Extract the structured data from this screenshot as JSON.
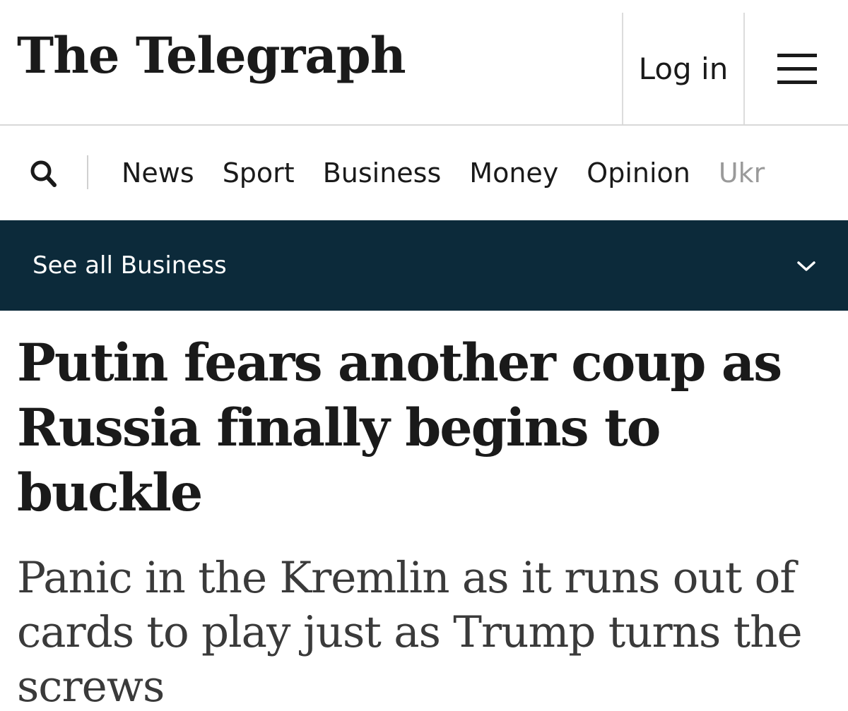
{
  "header": {
    "logo": "The Telegraph",
    "login_label": "Log in",
    "menu_icon": "hamburger-menu-icon"
  },
  "nav": {
    "search_icon": "search-icon",
    "items": [
      {
        "label": "News"
      },
      {
        "label": "Sport"
      },
      {
        "label": "Business"
      },
      {
        "label": "Money"
      },
      {
        "label": "Opinion"
      },
      {
        "label": "Ukr"
      }
    ]
  },
  "section_bar": {
    "label": "See all Business",
    "icon": "chevron-down-icon",
    "background": "#0c2a3a"
  },
  "article": {
    "headline": "Putin fears another coup as Russia finally begins to buckle",
    "standfirst": "Panic in the Kremlin as it runs out of cards to play just as Trump turns the screws"
  }
}
